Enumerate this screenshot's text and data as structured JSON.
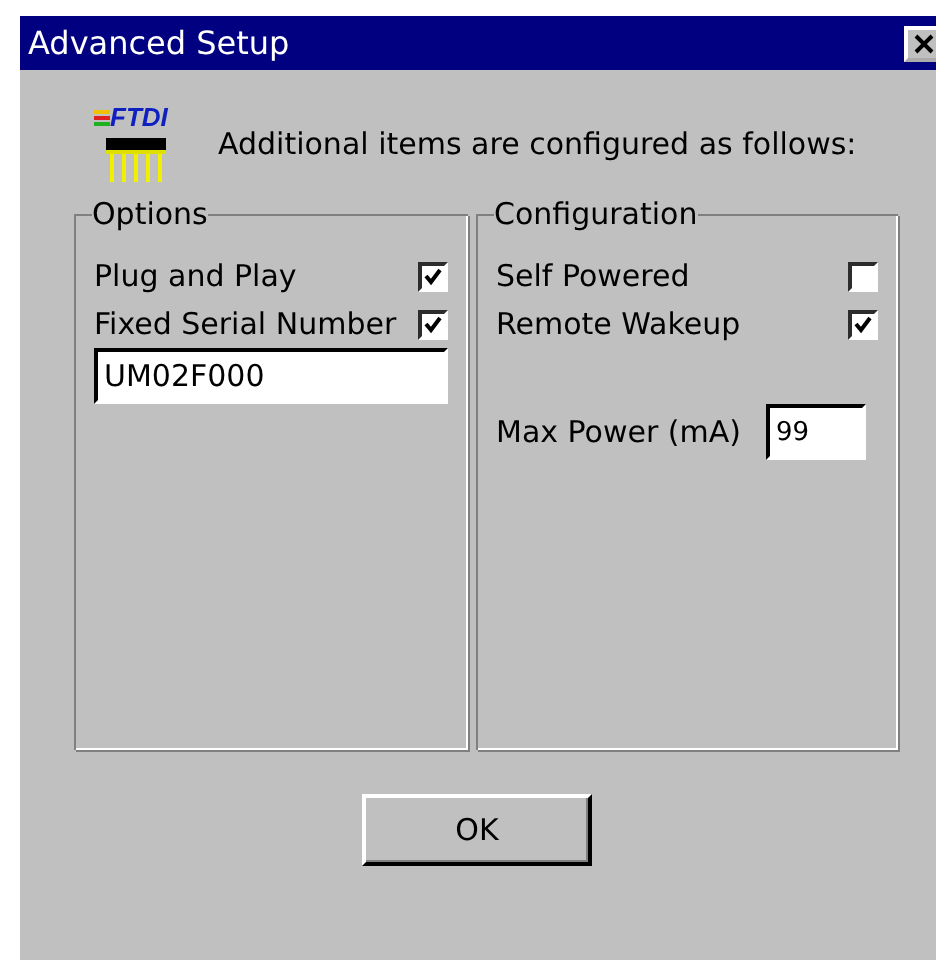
{
  "window": {
    "title": "Advanced Setup"
  },
  "header": {
    "logo_text": "FTDI",
    "message": "Additional items are configured as follows:"
  },
  "groups": [
    {
      "title": "Options",
      "items": [
        {
          "kind": "checkbox",
          "label": "Plug and Play",
          "checked": true
        },
        {
          "kind": "checkbox",
          "label": "Fixed Serial Number",
          "checked": true
        },
        {
          "kind": "field",
          "value": "UM02F000"
        }
      ]
    },
    {
      "title": "Configuration",
      "items": [
        {
          "kind": "checkbox",
          "label": "Self Powered",
          "checked": false
        },
        {
          "kind": "checkbox",
          "label": "Remote Wakeup",
          "checked": true
        },
        {
          "kind": "spacer"
        },
        {
          "kind": "labeled-field",
          "label": "Max Power (mA)",
          "value": "99"
        }
      ]
    }
  ],
  "buttons": [
    "OK"
  ]
}
